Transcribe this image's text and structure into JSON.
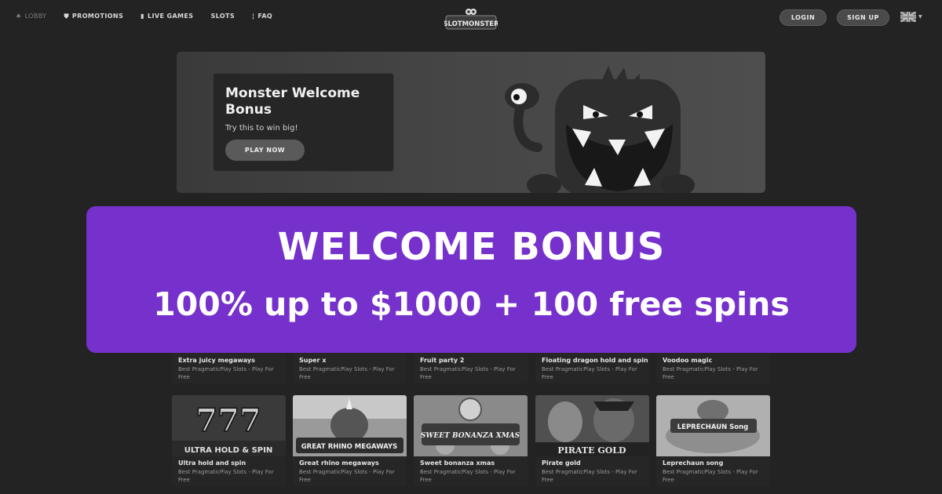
{
  "nav": {
    "items": [
      {
        "label": "LOBBY",
        "icon": "spade-icon",
        "active": false
      },
      {
        "label": "PROMOTIONS",
        "icon": "gift-icon",
        "active": true
      },
      {
        "label": "LIVE GAMES",
        "icon": "cards-icon",
        "active": true
      },
      {
        "label": "SLOTS",
        "icon": "slot-icon",
        "active": true
      },
      {
        "label": "FAQ",
        "icon": "question-icon",
        "active": true
      }
    ],
    "login_label": "LOGIN",
    "signup_label": "SIGN UP",
    "language_flag": "uk-flag-icon"
  },
  "logo": {
    "text": "SLOTMONSTER"
  },
  "hero": {
    "title": "Monster Welcome Bonus",
    "subtitle": "Try this to win big!",
    "cta_label": "PLAY NOW"
  },
  "overlay": {
    "title": "WELCOME BONUS",
    "subtitle": "100% up to $1000 + 100 free spins",
    "color": "#7630cc"
  },
  "games_row1": [
    {
      "name": "Extra juicy megaways",
      "desc": "Best PragmaticPlay Slots - Play For Free"
    },
    {
      "name": "Super x",
      "desc": "Best PragmaticPlay Slots - Play For Free"
    },
    {
      "name": "Fruit party 2",
      "desc": "Best PragmaticPlay Slots - Play For Free"
    },
    {
      "name": "Floating dragon hold and spin",
      "desc": "Best PragmaticPlay Slots - Play For Free"
    },
    {
      "name": "Voodoo magic",
      "desc": "Best PragmaticPlay Slots - Play For Free"
    }
  ],
  "games_row2": [
    {
      "name": "Ultra hold and spin",
      "desc": "Best PragmaticPlay Slots - Play For Free",
      "thumb_text": "ULTRA HOLD & SPIN"
    },
    {
      "name": "Great rhino megaways",
      "desc": "Best PragmaticPlay Slots - Play For Free",
      "thumb_text": "GREAT RHINO MEGAWAYS"
    },
    {
      "name": "Sweet bonanza xmas",
      "desc": "Best PragmaticPlay Slots - Play For Free",
      "thumb_text": "SWEET BONANZA XMAS"
    },
    {
      "name": "Pirate gold",
      "desc": "Best PragmaticPlay Slots - Play For Free",
      "thumb_text": "PIRATE GOLD"
    },
    {
      "name": "Leprechaun song",
      "desc": "Best PragmaticPlay Slots - Play For Free",
      "thumb_text": "LEPRECHAUN Song"
    }
  ]
}
